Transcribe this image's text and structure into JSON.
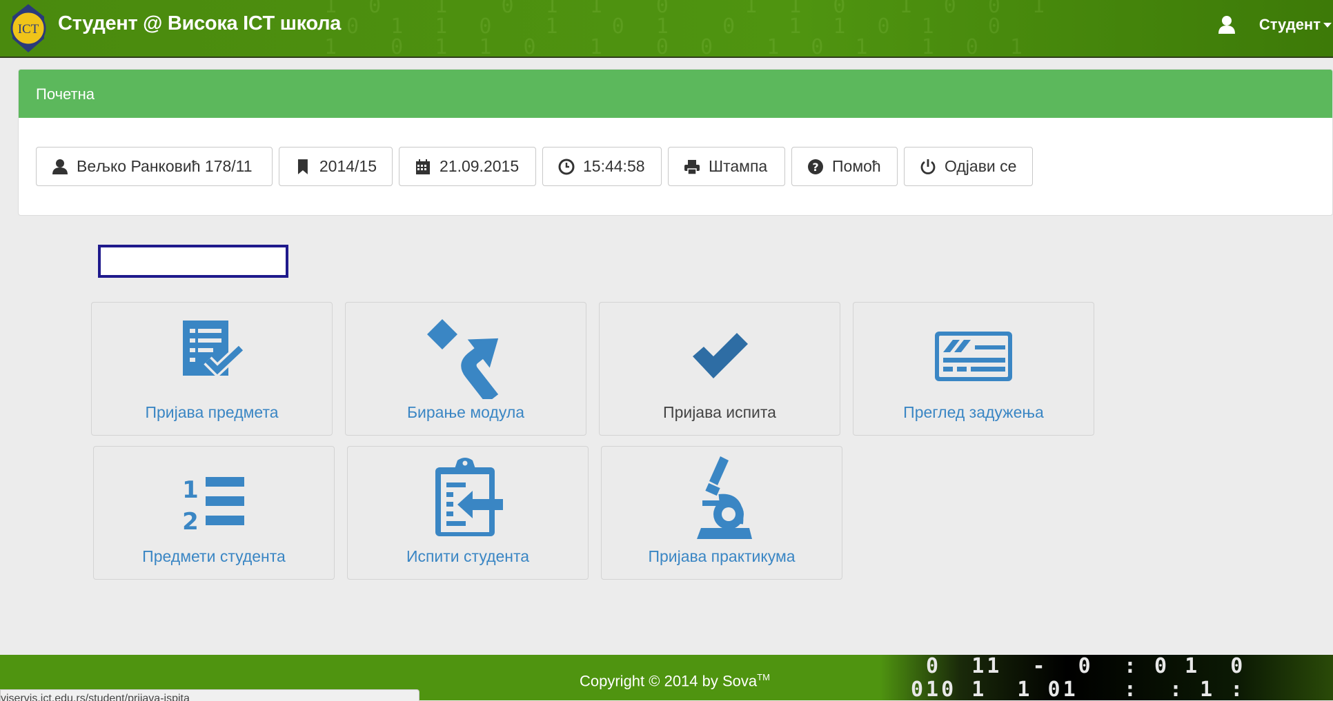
{
  "navbar": {
    "logo_text": "ICT",
    "brand": "Студент @ Висока ICT школа",
    "user_label": "Студент"
  },
  "panel": {
    "heading": "Почетна",
    "buttons": [
      {
        "icon": "user-icon",
        "label": "Вељко Ранковић 178/11"
      },
      {
        "icon": "bookmark-icon",
        "label": "2014/15"
      },
      {
        "icon": "calendar-icon",
        "label": "21.09.2015"
      },
      {
        "icon": "clock-icon",
        "label": "15:44:58"
      },
      {
        "icon": "print-icon",
        "label": "Штампа"
      },
      {
        "icon": "question-icon",
        "label": "Помоћ"
      },
      {
        "icon": "power-icon",
        "label": "Одјави се"
      }
    ]
  },
  "tiles": [
    {
      "icon": "checklist-icon",
      "label": "Пријава предмета"
    },
    {
      "icon": "fork-arrow-icon",
      "label": "Бирање модула"
    },
    {
      "icon": "checkmark-icon",
      "label": "Пријава испита"
    },
    {
      "icon": "card-icon",
      "label": "Преглед задужења"
    },
    {
      "icon": "ordered-list-icon",
      "label": "Предмети студента"
    },
    {
      "icon": "clipboard-import-icon",
      "label": "Испити студента"
    },
    {
      "icon": "microscope-icon",
      "label": "Пријава практикума"
    }
  ],
  "footer": {
    "copyright": "Copyright © 2014 by Sova",
    "trademark": "TM"
  },
  "statusbar": {
    "url": "viservis.ict.edu.rs/student/prijava-ispita"
  },
  "colors": {
    "navbar": "#4f9410",
    "panel_heading": "#5cb85c",
    "tile_icon": "#3a86c4",
    "tile_icon_dark": "#2e6da4",
    "focus_border": "#1f1a8c"
  }
}
